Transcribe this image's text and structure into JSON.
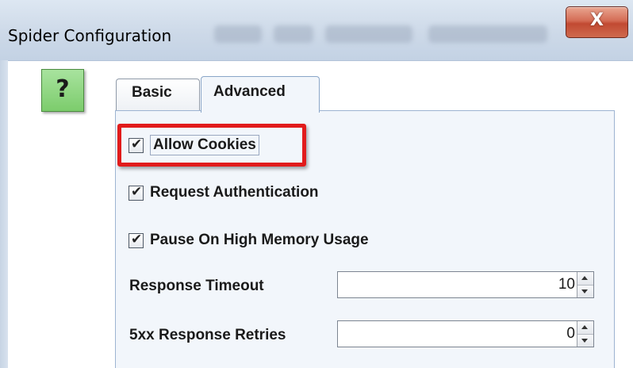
{
  "window": {
    "title": "Spider Configuration",
    "close_label": "X"
  },
  "help": {
    "label": "?"
  },
  "tabs": [
    {
      "label": "Basic",
      "selected": false
    },
    {
      "label": "Advanced",
      "selected": true
    }
  ],
  "options": [
    {
      "label": "Allow Cookies",
      "checked": true,
      "highlighted": true
    },
    {
      "label": "Request Authentication",
      "checked": true,
      "highlighted": false
    },
    {
      "label": "Pause On High Memory Usage",
      "checked": true,
      "highlighted": false
    }
  ],
  "fields": [
    {
      "label": "Response Timeout",
      "value": "10"
    },
    {
      "label": "5xx Response Retries",
      "value": "0"
    }
  ],
  "icons": {
    "check": "check-icon",
    "help": "help-icon",
    "close": "close-icon",
    "spinner_up": "arrow-up-icon",
    "spinner_down": "arrow-down-icon"
  },
  "colors": {
    "highlight": "#e11b1b",
    "help_button": "#7ccc6c",
    "close_button": "#c14a32",
    "panel_background": "#f2f6fb"
  }
}
